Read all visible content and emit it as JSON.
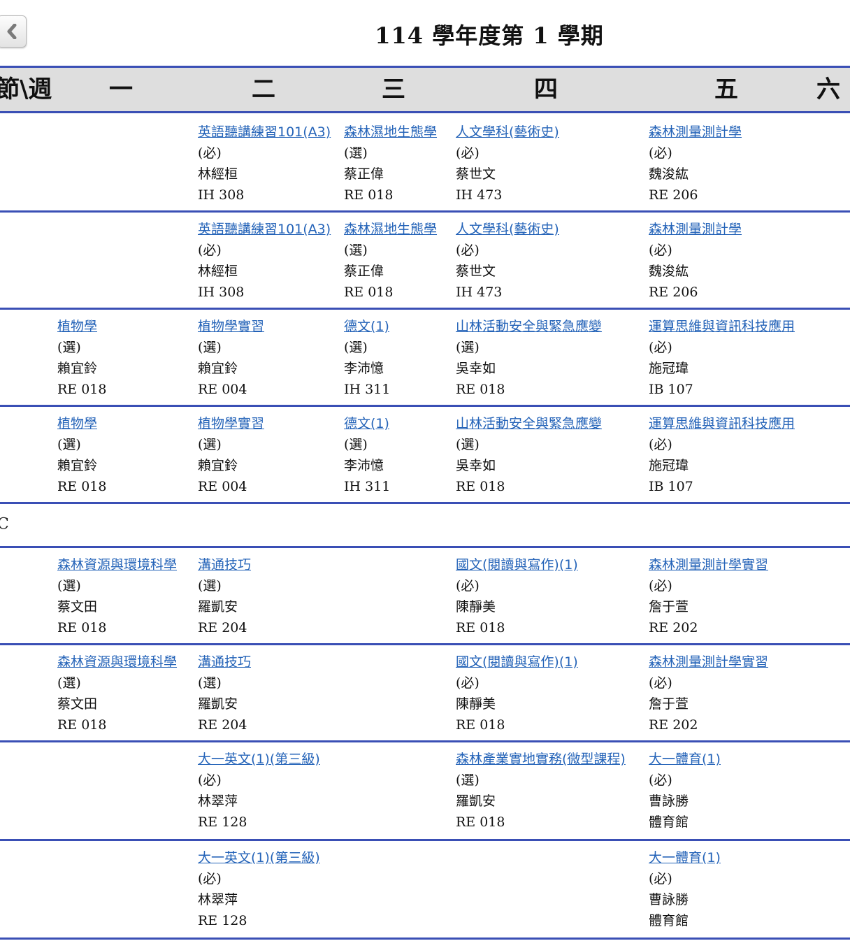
{
  "page": {
    "title": "114 學年度第 1 學期"
  },
  "header": {
    "corner": "節\\週",
    "days": [
      "一",
      "二",
      "三",
      "四",
      "五",
      "六"
    ]
  },
  "rows": [
    {
      "period": "",
      "courses": [
        {
          "day": 1,
          "name": "英語聽講練習101(A3)",
          "type": "(必)",
          "teacher": "林經桓",
          "room": "IH 308"
        },
        {
          "day": 2,
          "name": "森林濕地生態學",
          "type": "(選)",
          "teacher": "蔡正偉",
          "room": "RE 018"
        },
        {
          "day": 3,
          "name": "人文學科(藝術史)",
          "type": "(必)",
          "teacher": "蔡世文",
          "room": "IH 473"
        },
        {
          "day": 4,
          "name": "森林測量測計學",
          "type": "(必)",
          "teacher": "魏浚紘",
          "room": "RE 206"
        }
      ]
    },
    {
      "period": "",
      "courses": [
        {
          "day": 1,
          "name": "英語聽講練習101(A3)",
          "type": "(必)",
          "teacher": "林經桓",
          "room": "IH 308"
        },
        {
          "day": 2,
          "name": "森林濕地生態學",
          "type": "(選)",
          "teacher": "蔡正偉",
          "room": "RE 018"
        },
        {
          "day": 3,
          "name": "人文學科(藝術史)",
          "type": "(必)",
          "teacher": "蔡世文",
          "room": "IH 473"
        },
        {
          "day": 4,
          "name": "森林測量測計學",
          "type": "(必)",
          "teacher": "魏浚紘",
          "room": "RE 206"
        }
      ]
    },
    {
      "period": "",
      "courses": [
        {
          "day": 0,
          "name": "植物學",
          "type": "(選)",
          "teacher": "賴宜鈴",
          "room": "RE 018"
        },
        {
          "day": 1,
          "name": "植物學實習",
          "type": "(選)",
          "teacher": "賴宜鈴",
          "room": "RE 004"
        },
        {
          "day": 2,
          "name": "德文(1)",
          "type": "(選)",
          "teacher": "李沛憶",
          "room": "IH 311"
        },
        {
          "day": 3,
          "name": "山林活動安全與緊急應變",
          "type": "(選)",
          "teacher": "吳幸如",
          "room": "RE 018"
        },
        {
          "day": 4,
          "name": "運算思維與資訊科技應用",
          "type": "(必)",
          "teacher": "施冠瑋",
          "room": "IB 107"
        }
      ]
    },
    {
      "period": "",
      "courses": [
        {
          "day": 0,
          "name": "植物學",
          "type": "(選)",
          "teacher": "賴宜鈴",
          "room": "RE 018"
        },
        {
          "day": 1,
          "name": "植物學實習",
          "type": "(選)",
          "teacher": "賴宜鈴",
          "room": "RE 004"
        },
        {
          "day": 2,
          "name": "德文(1)",
          "type": "(選)",
          "teacher": "李沛憶",
          "room": "IH 311"
        },
        {
          "day": 3,
          "name": "山林活動安全與緊急應變",
          "type": "(選)",
          "teacher": "吳幸如",
          "room": "RE 018"
        },
        {
          "day": 4,
          "name": "運算思維與資訊科技應用",
          "type": "(必)",
          "teacher": "施冠瑋",
          "room": "IB 107"
        }
      ]
    },
    {
      "period": "C",
      "courses": []
    },
    {
      "period": "",
      "courses": [
        {
          "day": 0,
          "name": "森林資源與環境科學",
          "type": "(選)",
          "teacher": "蔡文田",
          "room": "RE 018"
        },
        {
          "day": 1,
          "name": "溝通技巧",
          "type": "(選)",
          "teacher": "羅凱安",
          "room": "RE 204"
        },
        {
          "day": 3,
          "name": "國文(閱讀與寫作)(1)",
          "type": "(必)",
          "teacher": "陳靜美",
          "room": "RE 018"
        },
        {
          "day": 4,
          "name": "森林測量測計學實習",
          "type": "(必)",
          "teacher": "詹于萱",
          "room": "RE 202"
        }
      ]
    },
    {
      "period": "",
      "courses": [
        {
          "day": 0,
          "name": "森林資源與環境科學",
          "type": "(選)",
          "teacher": "蔡文田",
          "room": "RE 018"
        },
        {
          "day": 1,
          "name": "溝通技巧",
          "type": "(選)",
          "teacher": "羅凱安",
          "room": "RE 204"
        },
        {
          "day": 3,
          "name": "國文(閱讀與寫作)(1)",
          "type": "(必)",
          "teacher": "陳靜美",
          "room": "RE 018"
        },
        {
          "day": 4,
          "name": "森林測量測計學實習",
          "type": "(必)",
          "teacher": "詹于萱",
          "room": "RE 202"
        }
      ]
    },
    {
      "period": "",
      "courses": [
        {
          "day": 1,
          "name": "大一英文(1)(第三級)",
          "type": "(必)",
          "teacher": "林翠萍",
          "room": "RE 128"
        },
        {
          "day": 3,
          "name": "森林產業實地實務(微型課程)",
          "type": "(選)",
          "teacher": "羅凱安",
          "room": "RE 018"
        },
        {
          "day": 4,
          "name": "大一體育(1)",
          "type": "(必)",
          "teacher": "曹詠勝",
          "room": "體育館"
        }
      ]
    },
    {
      "period": "",
      "courses": [
        {
          "day": 1,
          "name": "大一英文(1)(第三級)",
          "type": "(必)",
          "teacher": "林翠萍",
          "room": "RE 128"
        },
        {
          "day": 4,
          "name": "大一體育(1)",
          "type": "(必)",
          "teacher": "曹詠勝",
          "room": "體育館"
        }
      ]
    }
  ]
}
